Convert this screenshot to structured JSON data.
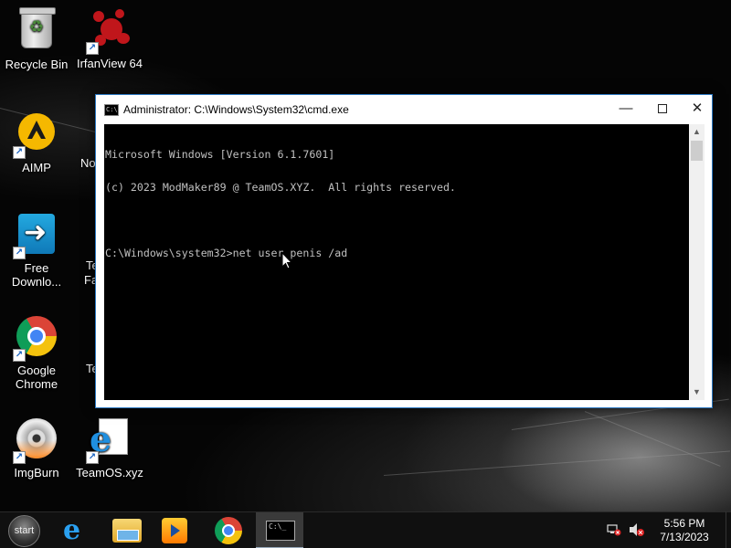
{
  "desktop": {
    "icons": [
      {
        "label": "Recycle Bin"
      },
      {
        "label": "IrfanView 64"
      },
      {
        "label": "AIMP"
      },
      {
        "label": "Free Downlo..."
      },
      {
        "label": "Google Chrome"
      },
      {
        "label": "ImgBurn"
      },
      {
        "label": "TeamOS.xyz"
      }
    ],
    "partial_labels": [
      "No",
      "Te",
      "Fa",
      "Te"
    ]
  },
  "cmd_window": {
    "title": "Administrator: C:\\Windows\\System32\\cmd.exe",
    "icon_text": "C:\\",
    "console_lines": [
      "Microsoft Windows [Version 6.1.7601]",
      "(c) 2023 ModMaker89 @ TeamOS.XYZ.  All rights reserved.",
      "",
      "C:\\Windows\\system32>net user penis /ad"
    ],
    "buttons": {
      "minimize": "—",
      "close": "✕"
    }
  },
  "taskbar": {
    "start_label": "start",
    "cmd_icon_text": "C:\\_",
    "clock": {
      "time": "5:56 PM",
      "date": "7/13/2023"
    }
  },
  "colors": {
    "console_bg": "#000000",
    "console_fg": "#c0c0c0",
    "window_border": "#2b78c2",
    "taskbar_bg": "#101010"
  }
}
